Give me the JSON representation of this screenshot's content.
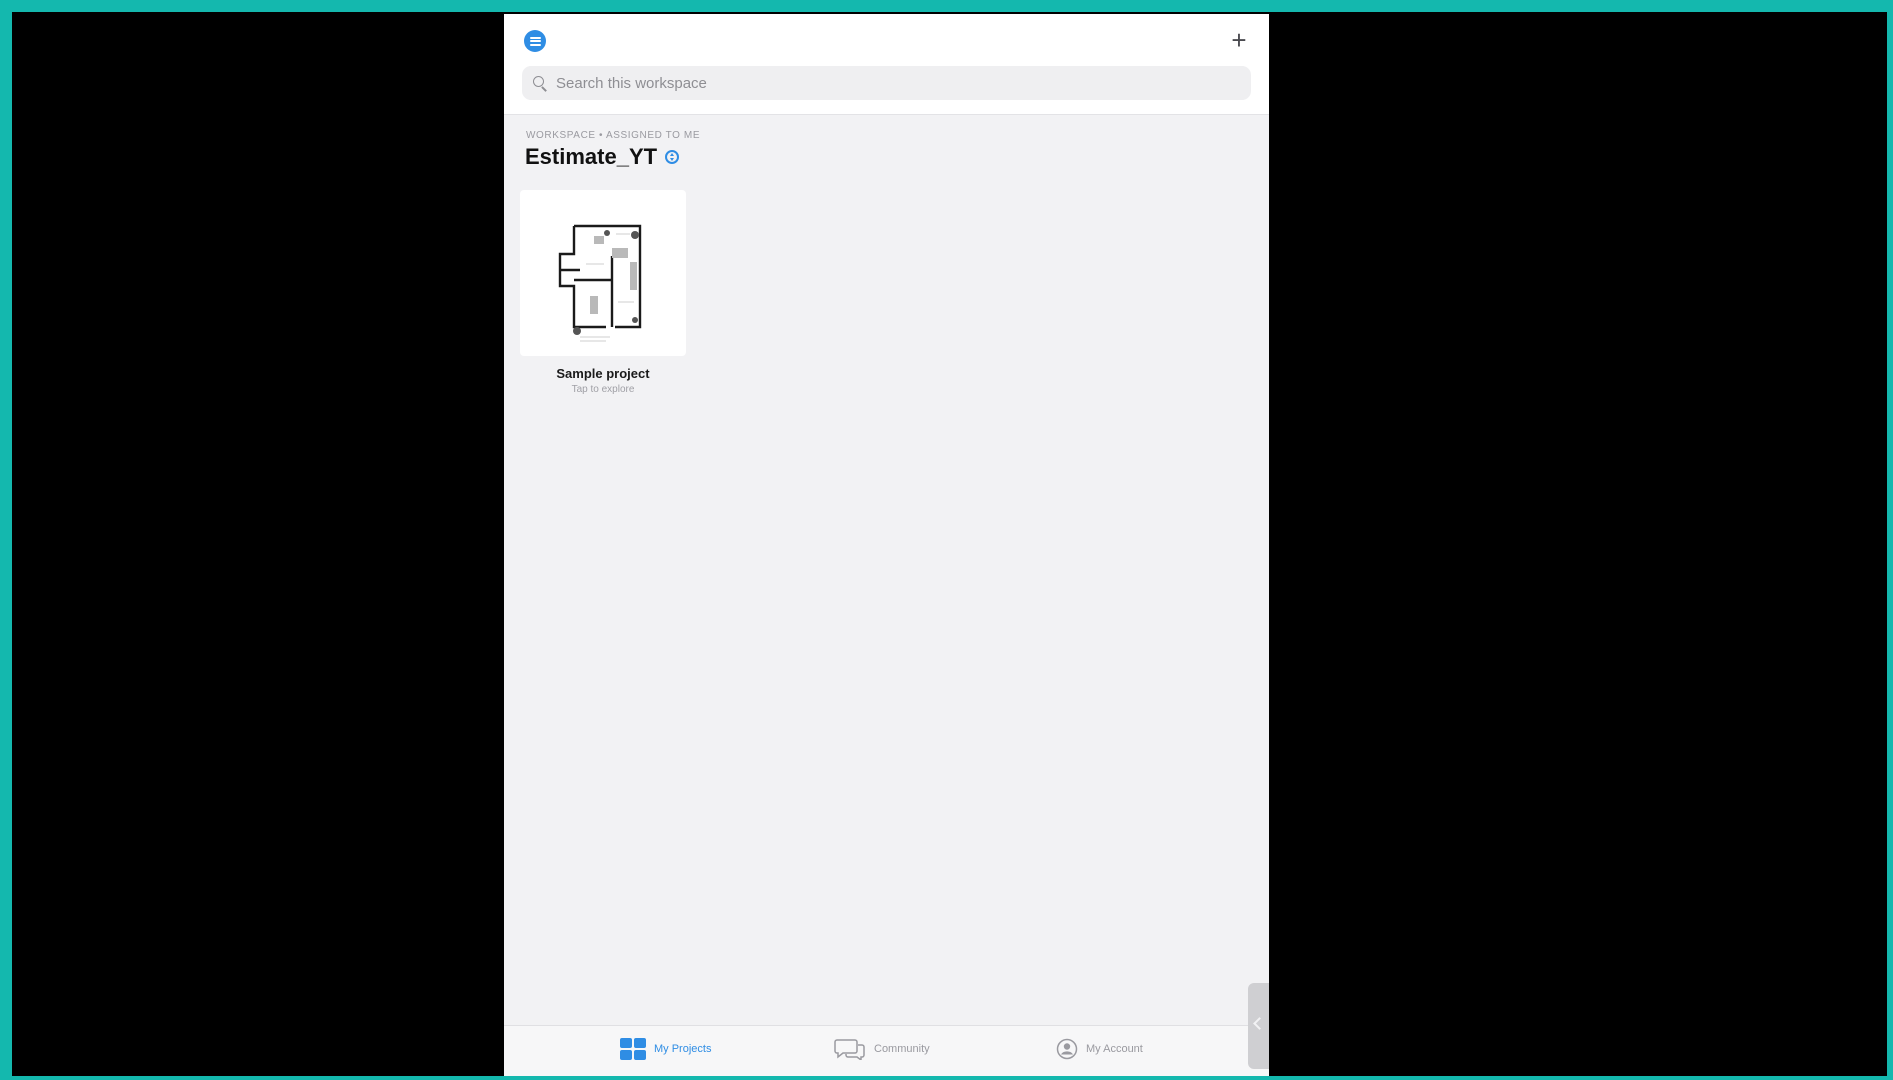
{
  "header": {
    "search_placeholder": "Search this workspace",
    "menu_icon": "menu-icon",
    "add_icon": "plus-icon"
  },
  "workspace": {
    "caption": "WORKSPACE • ASSIGNED TO ME",
    "name": "Estimate_YT"
  },
  "projects": [
    {
      "name": "Sample project",
      "subtitle": "Tap to explore",
      "thumbnail": "floor-plan-thumbnail"
    }
  ],
  "tabbar": {
    "tabs": [
      {
        "label": "My Projects",
        "icon": "grid-icon",
        "active": true
      },
      {
        "label": "Community",
        "icon": "chat-bubbles-icon",
        "active": false
      },
      {
        "label": "My Account",
        "icon": "user-circle-icon",
        "active": false
      }
    ]
  },
  "colors": {
    "accent": "#2f8de4",
    "frame_border": "#14b8ae",
    "background": "#000000",
    "app_background": "#f2f2f4"
  }
}
